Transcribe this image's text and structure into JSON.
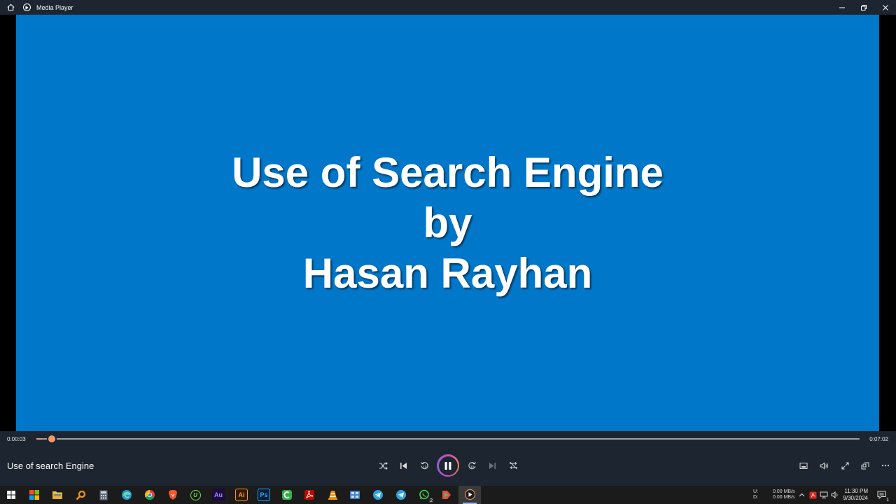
{
  "titlebar": {
    "app_name": "Media Player"
  },
  "video": {
    "lines": [
      "Use of Search Engine",
      "by",
      "Hasan Rayhan"
    ]
  },
  "player": {
    "current_time": "0:00:03",
    "total_time": "0:07:02",
    "progress_fraction": 0.0071,
    "media_title": "Use of search Engine"
  },
  "tray": {
    "upload_label": "U:",
    "download_label": "D:",
    "upload_speed": "0.00 MB/s",
    "download_speed": "0.00 MB/s",
    "time": "11:30 PM",
    "date": "9/30/2024",
    "whatsapp_badge": "2",
    "notification_badge": "1"
  },
  "taskbar_labels": {
    "audition": "Au",
    "illustrator": "Ai",
    "photoshop": "Ps",
    "upwork": "U"
  },
  "colors": {
    "video_bg": "#0077c8",
    "accent": "#f39a6b",
    "chrome_bg": "#1d2630",
    "taskbar_bg": "#1b1b1b"
  }
}
